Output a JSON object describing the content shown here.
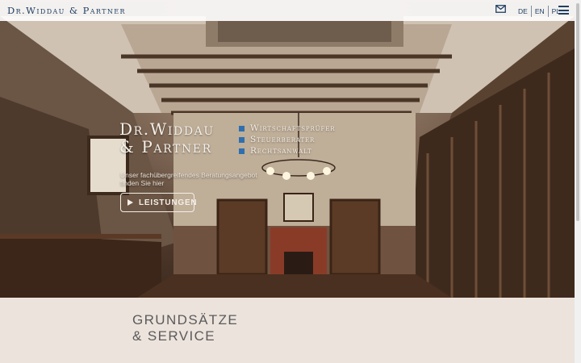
{
  "header": {
    "logo_text": "Dr.Widdau & Partner",
    "mail_icon": "mail-icon",
    "languages": [
      "DE",
      "EN",
      "PL"
    ],
    "menu_icon": "hamburger-menu-icon"
  },
  "hero": {
    "brand_line1": "Dr.Widdau",
    "brand_line2": "& Partner",
    "services": [
      "Wirtschaftsprüfer",
      "Steuerberater",
      "Rechtsanwalt"
    ],
    "tagline": "Unser fachübergreifendes Beratungsangebot finden Sie hier",
    "button_label": "LEISTUNGEN",
    "button_icon": "play-icon",
    "service_dot_color": "#2f6fb0"
  },
  "section": {
    "title_line1": "GRUNDSÄTZE",
    "title_line2": "& SERVICE"
  },
  "colors": {
    "brand": "#1f3f63",
    "section_bg": "#ece3dc"
  }
}
